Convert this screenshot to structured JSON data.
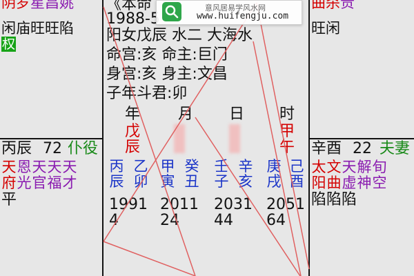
{
  "watermark": {
    "title": "意风居易学风水网",
    "url": "www.huifengju.com",
    "icon": "search-icon"
  },
  "top_left": {
    "stars_top": [
      "阴",
      "罗",
      "星",
      "昌",
      "姚"
    ],
    "stars_bottom": [
      "闲",
      "庙",
      "旺",
      "旺",
      "陷"
    ],
    "badge": "权"
  },
  "center_info": {
    "line1": "《本命",
    "line2": "1988-5",
    "line3": "阳女戊辰  水二  大海水",
    "line4": "命宫:亥   命主:巨门",
    "line5": "身宫:亥   身主:文昌",
    "line6": "子年斗君:卯"
  },
  "top_right": {
    "stars_top": [
      "曲",
      "杀",
      "贵"
    ],
    "stars_bottom": [
      "旺",
      "闲"
    ]
  },
  "pillars": {
    "headers": [
      "年",
      "月",
      "日",
      "时"
    ],
    "heavenly_red": [
      "戊",
      "",
      "",
      "甲"
    ],
    "earthly_red": [
      "辰",
      "",
      "",
      "午"
    ]
  },
  "left_cell": {
    "palace": "丙辰",
    "age": "72",
    "name": "仆役",
    "stars": [
      "天",
      "恩",
      "天",
      "天",
      "天"
    ],
    "stars2": [
      "府",
      "光",
      "官",
      "福",
      "才"
    ],
    "status": "平"
  },
  "right_cell": {
    "palace": "辛酉",
    "age": "22",
    "name": "夫妻",
    "stars": [
      "太",
      "文",
      "天",
      "解",
      "旬"
    ],
    "stars2": [
      "阳",
      "曲",
      "虚",
      "神",
      "空"
    ],
    "status": "陷陷陷"
  },
  "luck_cycles": {
    "stems": [
      "丙",
      "乙",
      "甲",
      "癸",
      "壬",
      "辛",
      "庚",
      "己"
    ],
    "branches": [
      "辰",
      "卯",
      "寅",
      "丑",
      "子",
      "亥",
      "戌",
      "酉"
    ],
    "years": [
      "1991",
      "2011",
      "2031",
      "2051"
    ],
    "ages": [
      "4",
      "24",
      "44",
      "64"
    ]
  },
  "colors": {
    "background": "#e7e7e7",
    "red": "#d40000",
    "purple": "#8a1bb0",
    "blue": "#1b35c8",
    "green": "#198a19",
    "line": "#e06060"
  }
}
